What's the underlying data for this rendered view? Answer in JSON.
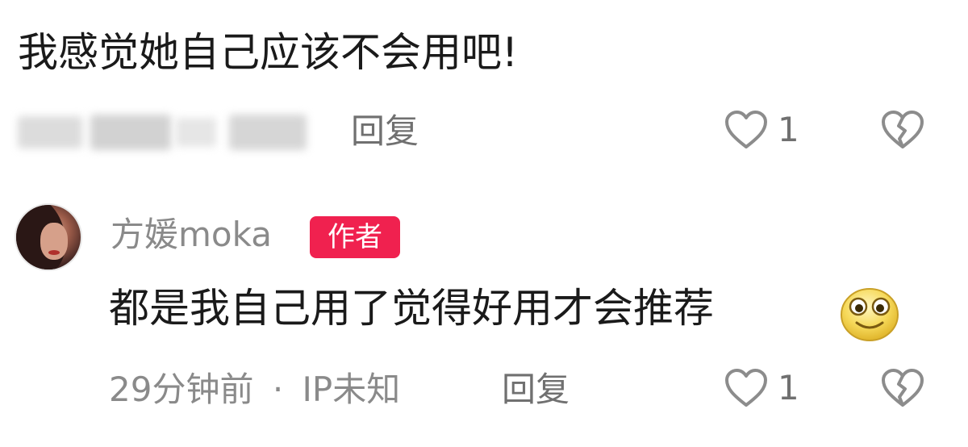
{
  "comment1": {
    "text": "我感觉她自己应该不会用吧!",
    "reply_label": "回复",
    "like_count": "1"
  },
  "comment2": {
    "username": "方媛moka",
    "author_badge": "作者",
    "text": "都是我自己用了觉得好用才会推荐",
    "emoji": "smiling-face-emoji",
    "time": "29分钟前",
    "separator": "·",
    "location": "IP未知",
    "reply_label": "回复",
    "like_count": "1"
  },
  "icons": {
    "like": "heart-outline-icon",
    "dislike": "broken-heart-icon"
  },
  "colors": {
    "badge": "#f0214f",
    "text": "#1a1a1a",
    "secondary": "#8a8a8a"
  }
}
